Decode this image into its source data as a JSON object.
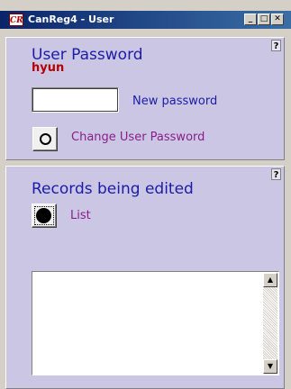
{
  "window": {
    "title": "CanReg4 - User",
    "icon_text": "CR",
    "minimize_label": "_",
    "maximize_label": "□",
    "close_label": "✕"
  },
  "password_panel": {
    "help_label": "?",
    "heading": "User Password",
    "username": "hyun",
    "new_password_value": "",
    "new_password_label": "New password",
    "change_button_label": "Change User Password"
  },
  "records_panel": {
    "help_label": "?",
    "heading": "Records being edited",
    "list_label": "List",
    "textarea_value": "",
    "scroll_up_icon": "▲",
    "scroll_down_icon": "▼"
  },
  "colors": {
    "heading": "#1c1ca8",
    "username": "#b40000",
    "panel_bg": "#cac6e3",
    "link_purple": "#8b1e8b"
  }
}
